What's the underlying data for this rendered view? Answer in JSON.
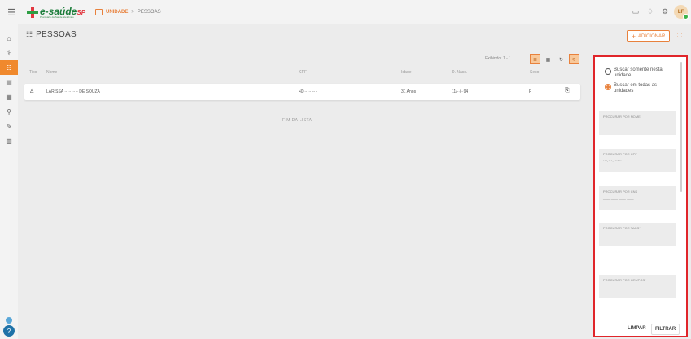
{
  "header": {
    "logo_main": "e-saúde",
    "logo_region": "SP",
    "logo_sub": "Prontuário de Saúde Eletrônico",
    "unit_label": "UNIDADE",
    "separator": ">",
    "page_crumb": "PESSOAS",
    "avatar_initials": "LF"
  },
  "page": {
    "title": "PESSOAS",
    "add_button": "ADICIONAR",
    "exibindo": "Exibindo: 1 - 1"
  },
  "table": {
    "headers": [
      "Tipo",
      "Nome",
      "CPF",
      "Idade",
      "D. Nasc.",
      "Sexo"
    ],
    "rows": [
      {
        "nome": "LARISSA ·········· DE SOUZA",
        "cpf": "40··········",
        "idade": "31 Anos",
        "nasc": "11/··/··94",
        "sexo": "F"
      }
    ],
    "end_label": "FIM DA LISTA"
  },
  "filter_panel": {
    "radio_local": "Buscar somente nesta unidade",
    "radio_all": "Buscar em todas as unidades",
    "fields": [
      {
        "label": "PROCURAR POR NOME",
        "value": ""
      },
      {
        "label": "PROCURAR POR CPF",
        "value": "···.···.···-··"
      },
      {
        "label": "PROCURAR POR CNS",
        "value": "___ ___ ___ ___"
      },
      {
        "label": "PROCURAR POR TAGS*",
        "value": ""
      },
      {
        "label": "PROCURAR POR GRUPOS*",
        "value": ""
      }
    ],
    "clear_button": "LIMPAR",
    "filter_button": "FILTRAR"
  }
}
